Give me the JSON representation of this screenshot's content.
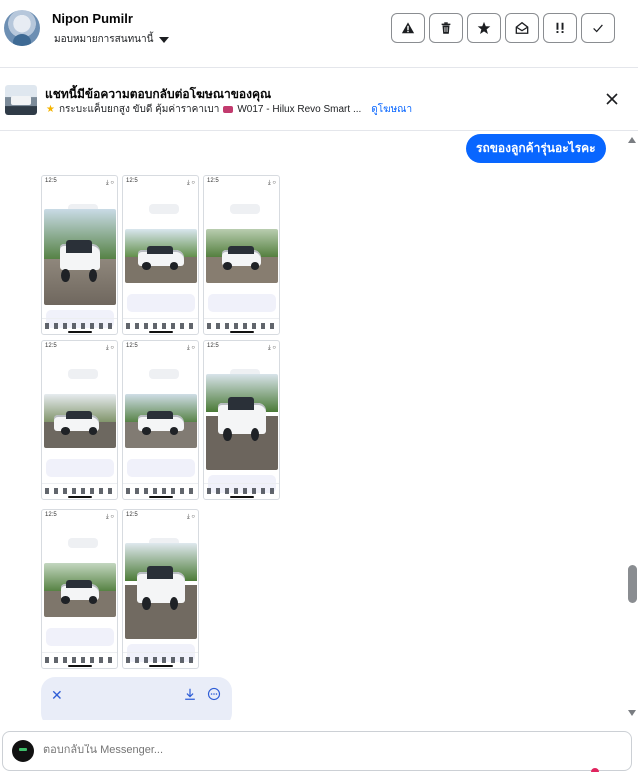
{
  "header": {
    "user_name": "Nipon Pumilr",
    "assign_label": "มอบหมายการสนทนานี้",
    "actions": [
      {
        "name": "warning-icon"
      },
      {
        "name": "trash-icon"
      },
      {
        "name": "star-icon"
      },
      {
        "name": "mark-unread-icon"
      },
      {
        "name": "priority-icon"
      },
      {
        "name": "check-icon"
      }
    ]
  },
  "banner": {
    "title": "แชทนี้มีข้อความตอบกลับต่อโฆษณาของคุณ",
    "desc_prefix": "กระบะแค็บยกสูง ขับดี คุ้มค่าราคาเบา",
    "desc_suffix": "W017 - Hilux Revo Smart ...",
    "link_label": "ดูโฆษณา"
  },
  "chat": {
    "outgoing_message": "รถของลูกค้ารุ่นอะไรคะ",
    "screenshot_top_left": "12:5",
    "screenshot_top_right": "⤓ ○"
  },
  "composer": {
    "placeholder": "ตอบกลับใน Messenger..."
  },
  "colors": {
    "accent": "#0866ff",
    "border": "#e4e6eb",
    "preview_bg": "#e9edf8"
  }
}
